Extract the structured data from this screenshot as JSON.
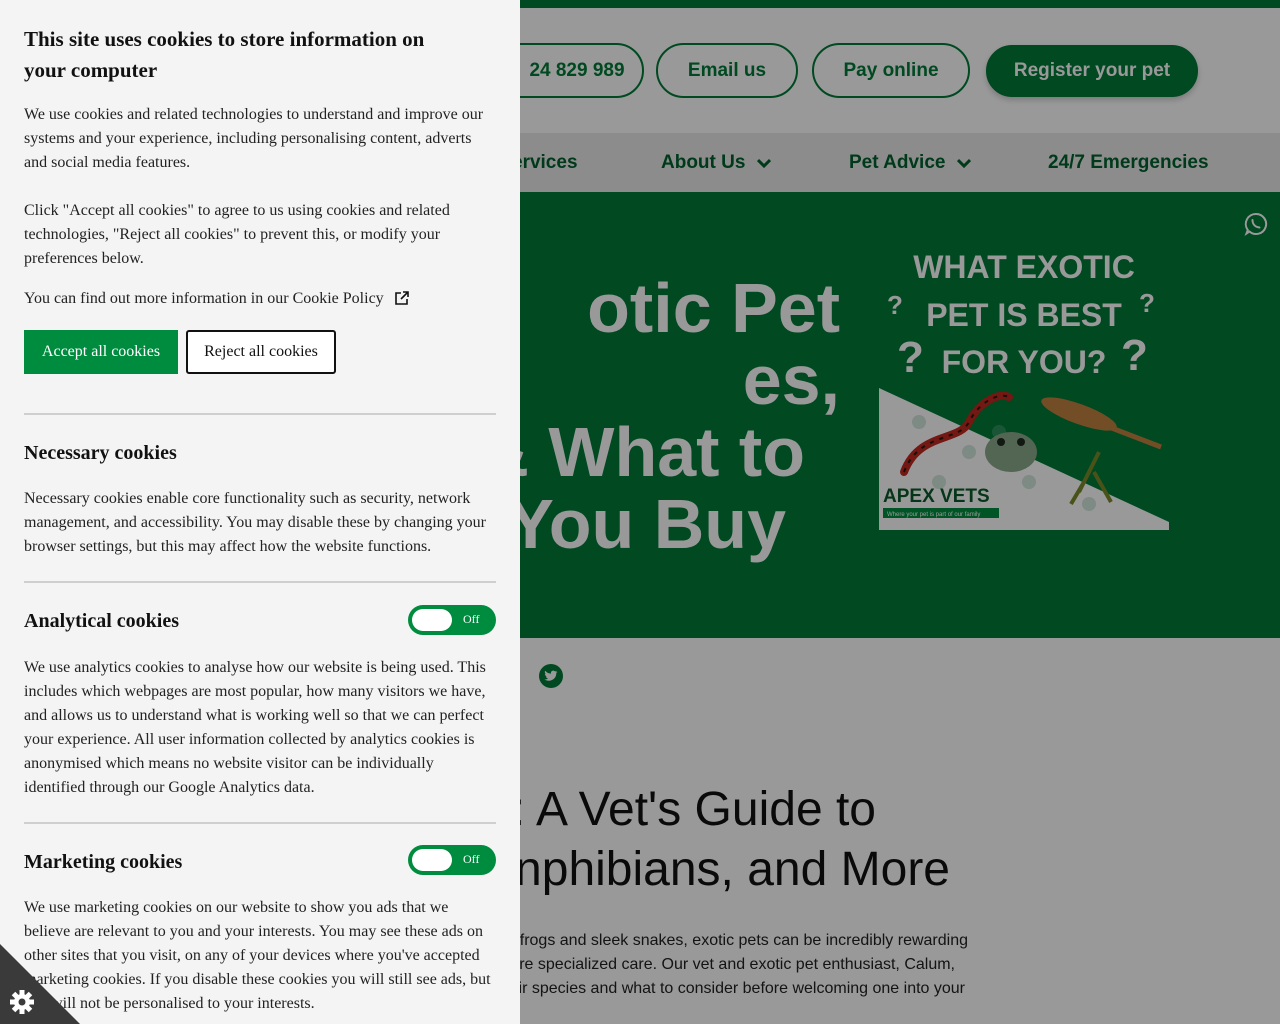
{
  "header": {
    "phone_label": "24 829 989",
    "email_label": "Email us",
    "pay_label": "Pay online",
    "register_label": "Register your pet"
  },
  "nav": {
    "items": [
      {
        "label": "ervices"
      },
      {
        "label": "About Us"
      },
      {
        "label": "Pet Advice"
      },
      {
        "label": "24/7 Emergencies"
      }
    ]
  },
  "hero": {
    "title_lines": [
      "otic Pet",
      "es,",
      "& What to",
      "You Buy"
    ],
    "image": {
      "heading_lines": [
        "WHAT EXOTIC",
        "PET IS BEST",
        "FOR YOU?"
      ],
      "brand": "APEX VETS",
      "tagline": "Where your pet is part of our family"
    }
  },
  "article": {
    "title_lines": [
      ": A Vet's Guide to",
      "nphibians, and More"
    ],
    "text_lines": [
      "frogs and sleek snakes, exotic pets can be incredibly rewarding",
      "re specialized care. Our vet and exotic pet enthusiast, Calum,",
      "ir species and what to consider before welcoming one into your"
    ]
  },
  "cookie_panel": {
    "title": "This site uses cookies to store information on your computer",
    "intro": "We use cookies and related technologies to understand and improve our systems and your experience, including personalising content, adverts and social media features.",
    "instructions": "Click \"Accept all cookies\" to agree to us using cookies and related technologies, \"Reject all cookies\" to prevent this, or modify your preferences below.",
    "policy_prefix": "You can find out more information in our",
    "policy_link": "Cookie Policy",
    "accept_label": "Accept all cookies",
    "reject_label": "Reject all cookies",
    "necessary": {
      "heading": "Necessary cookies",
      "text": "Necessary cookies enable core functionality such as security, network management, and accessibility. You may disable these by changing your browser settings, but this may affect how the website functions."
    },
    "analytical": {
      "heading": "Analytical cookies",
      "toggle_label": "Off",
      "text": "We use analytics cookies to analyse how our website is being used. This includes which webpages are most popular, how many visitors we have, and allows us to understand what is working well so that we can perfect your experience. All user information collected by analytics cookies is anonymised which means no website visitor can be individually identified through our Google Analytics data."
    },
    "marketing": {
      "heading": "Marketing cookies",
      "toggle_label": "Off",
      "text": "We use marketing cookies on our website to show you ads that we believe are relevant to you and your interests. You may see these ads on other sites that you visit, on any of your devices where you've accepted marketing cookies. If you disable these cookies you will still see ads, but just will not be personalised to your interests."
    }
  },
  "colors": {
    "brand_green": "#007a37",
    "button_green": "#008c3f",
    "panel_bg": "#f4f4f4"
  }
}
